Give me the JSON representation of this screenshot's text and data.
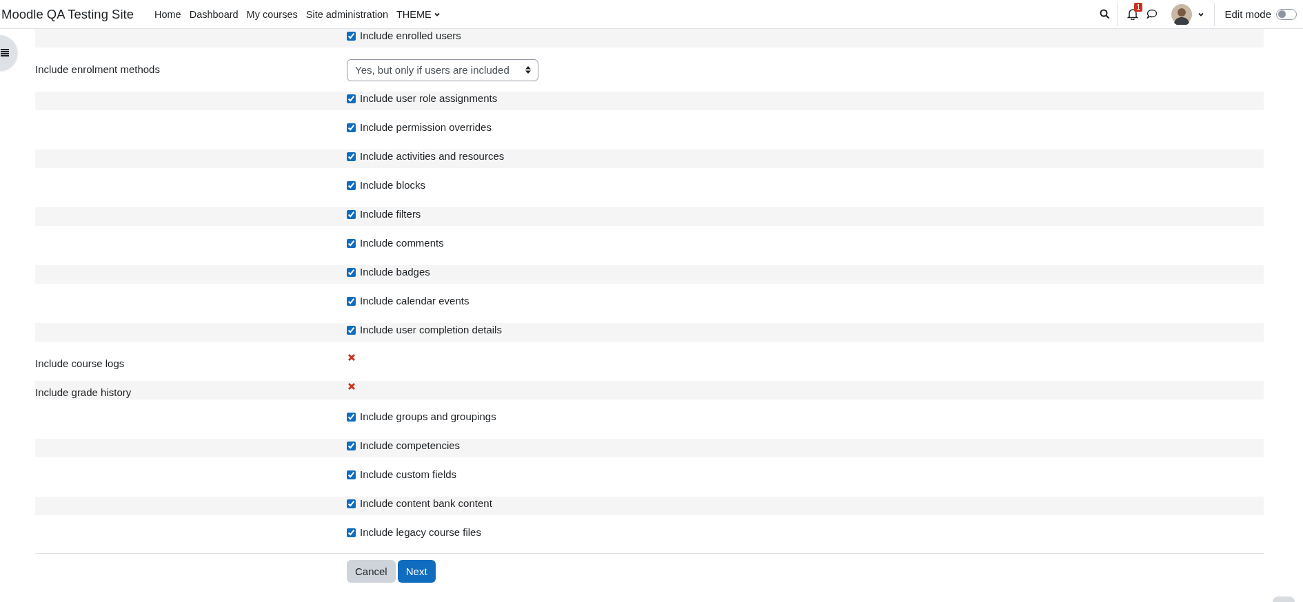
{
  "header": {
    "site_name": "Moodle QA Testing Site",
    "nav": [
      {
        "label": "Home",
        "dropdown": false
      },
      {
        "label": "Dashboard",
        "dropdown": false
      },
      {
        "label": "My courses",
        "dropdown": false
      },
      {
        "label": "Site administration",
        "dropdown": false
      },
      {
        "label": "THEME",
        "dropdown": true
      }
    ],
    "notifications_badge": "1",
    "edit_mode": {
      "label": "Edit mode",
      "on": false
    }
  },
  "settings": [
    {
      "kind": "checkbox",
      "option": "Include enrolled users",
      "checked": true
    },
    {
      "kind": "select",
      "label": "Include enrolment methods",
      "value": "Yes, but only if users are included"
    },
    {
      "kind": "checkbox",
      "option": "Include user role assignments",
      "checked": true
    },
    {
      "kind": "checkbox",
      "option": "Include permission overrides",
      "checked": true
    },
    {
      "kind": "checkbox",
      "option": "Include activities and resources",
      "checked": true
    },
    {
      "kind": "checkbox",
      "option": "Include blocks",
      "checked": true
    },
    {
      "kind": "checkbox",
      "option": "Include filters",
      "checked": true
    },
    {
      "kind": "checkbox",
      "option": "Include comments",
      "checked": true
    },
    {
      "kind": "checkbox",
      "option": "Include badges",
      "checked": true
    },
    {
      "kind": "checkbox",
      "option": "Include calendar events",
      "checked": true
    },
    {
      "kind": "checkbox",
      "option": "Include user completion details",
      "checked": true
    },
    {
      "kind": "cross",
      "label": "Include course logs"
    },
    {
      "kind": "cross",
      "label": "Include grade history"
    },
    {
      "kind": "checkbox",
      "option": "Include groups and groupings",
      "checked": true
    },
    {
      "kind": "checkbox",
      "option": "Include competencies",
      "checked": true
    },
    {
      "kind": "checkbox",
      "option": "Include custom fields",
      "checked": true
    },
    {
      "kind": "checkbox",
      "option": "Include content bank content",
      "checked": true
    },
    {
      "kind": "checkbox",
      "option": "Include legacy course files",
      "checked": true
    }
  ],
  "buttons": [
    {
      "label": "Cancel",
      "primary": false
    },
    {
      "label": "Next",
      "primary": true
    }
  ]
}
